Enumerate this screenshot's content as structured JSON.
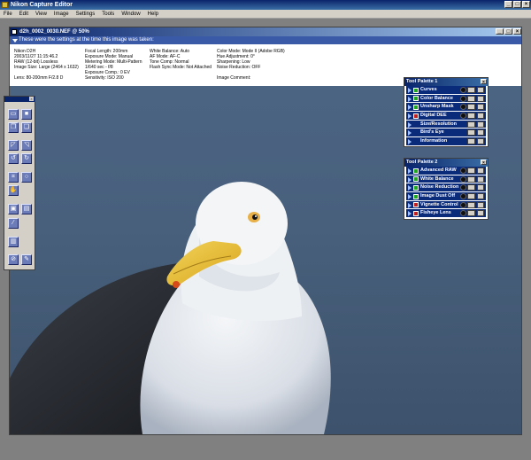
{
  "app": {
    "title": "Nikon Capture Editor"
  },
  "menu": [
    "File",
    "Edit",
    "View",
    "Image",
    "Settings",
    "Tools",
    "Window",
    "Help"
  ],
  "document": {
    "title": "d2h_0002_0030.NEF @ 50%",
    "info_bar": "These were the settings at the time this image was taken:",
    "meta_col1": [
      "Nikon D2H",
      "2003/11/27 11:15:46.2",
      "RAW (12-bit) Lossless",
      "Image Size: Large (2464 x 1632)",
      "",
      "Lens: 80-200mm F/2.8 D"
    ],
    "meta_col2": [
      "Focal Length: 200mm",
      "Exposure Mode: Manual",
      "Metering Mode: Multi-Pattern",
      "1/640 sec - f/8",
      "Exposure Comp.: 0 EV",
      "Sensitivity: ISO 200"
    ],
    "meta_col3": [
      "White Balance: Auto",
      "AF Mode: AF-C",
      "Tone Comp: Normal",
      "Flash Sync Mode: Not Attached"
    ],
    "meta_col4": [
      "Color Mode: Mode II (Adobe RGB)",
      "Hue Adjustment: 0°",
      "Sharpening: Low",
      "Noise Reduction: OFF",
      "",
      "Image Comment:"
    ]
  },
  "palette1": {
    "title": "Tool Palette 1",
    "items": [
      {
        "label": "Curves",
        "check": "on"
      },
      {
        "label": "Color Balance",
        "check": "on"
      },
      {
        "label": "Unsharp Mask",
        "check": "on"
      },
      {
        "label": "Digital DEE",
        "check": "off"
      },
      {
        "label": "Size/Resolution",
        "check": "none"
      },
      {
        "label": "Bird's Eye",
        "check": "none"
      },
      {
        "label": "Information",
        "check": "none"
      }
    ]
  },
  "palette2": {
    "title": "Tool Palette 2",
    "items": [
      {
        "label": "Advanced RAW",
        "check": "on"
      },
      {
        "label": "White Balance",
        "check": "on"
      },
      {
        "label": "Noise Reduction",
        "check": "on"
      },
      {
        "label": "Image Dust Off",
        "check": "on"
      },
      {
        "label": "Vignette Control",
        "check": "off"
      },
      {
        "label": "Fisheye Lens",
        "check": "off"
      }
    ]
  },
  "colors": {
    "titlebar": "#0a246a",
    "palette_row": "#0a2a7a",
    "check_on": "#1ea820",
    "check_off": "#c02020",
    "photo_bg": "#48607c"
  },
  "icons": [
    "app-icon",
    "minimize-icon",
    "maximize-icon",
    "close-icon",
    "open-folder-icon",
    "save-icon",
    "copy-icon",
    "paste-icon",
    "undo-icon",
    "redo-icon",
    "rotate-left-icon",
    "rotate-right-icon",
    "crop-icon",
    "zoom-icon",
    "hand-icon",
    "fit-icon",
    "actual-size-icon",
    "eyedropper-icon",
    "histogram-icon",
    "no-icon",
    "settings-icon"
  ]
}
